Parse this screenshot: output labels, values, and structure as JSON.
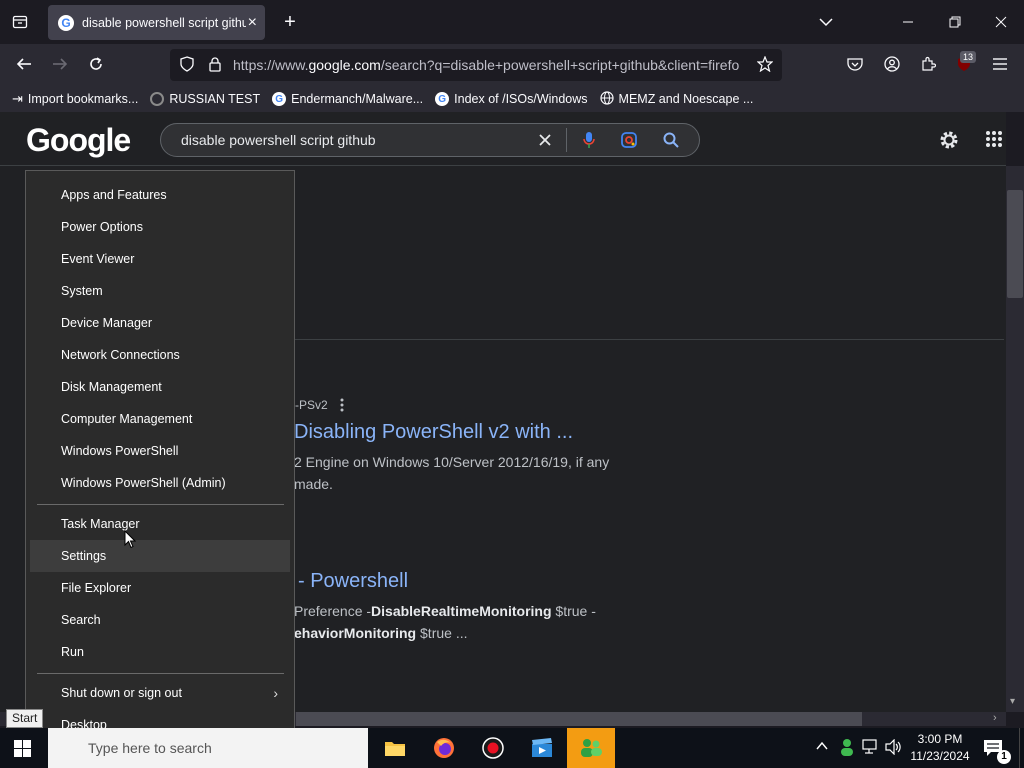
{
  "browser": {
    "tab_title": "disable powershell script github",
    "url_prefix": "https://www.",
    "url_host": "google.com",
    "url_rest": "/search?q=disable+powershell+script+github&client=firefo",
    "badge_count": "13",
    "bookmarks": [
      {
        "label": "Import bookmarks...",
        "icon": "import-icon"
      },
      {
        "label": "RUSSIAN TEST",
        "icon": "bookmark-favicon"
      },
      {
        "label": "Endermanch/Malware...",
        "icon": "google-favicon"
      },
      {
        "label": "Index of /ISOs/Windows",
        "icon": "google-favicon"
      },
      {
        "label": "MEMZ and Noescape ...",
        "icon": "globe-icon"
      }
    ]
  },
  "google": {
    "logo": "Google",
    "query": "disable powershell script github",
    "results": [
      {
        "crumb": "-PSv2",
        "title": "Disabling PowerShell v2 with ...",
        "snippet_1": "2 Engine on Windows 10/Server 2012/16/19, if any",
        "snippet_2": "made."
      },
      {
        "title": "- Powershell",
        "snippet_1a": "Preference -",
        "snippet_1b": "DisableRealtimeMonitoring",
        "snippet_1c": " $true -",
        "snippet_2a": "ehaviorMonitoring",
        "snippet_2b": " $true ..."
      }
    ]
  },
  "winx_menu": {
    "group1": [
      "Apps and Features",
      "Power Options",
      "Event Viewer",
      "System",
      "Device Manager",
      "Network Connections",
      "Disk Management",
      "Computer Management",
      "Windows PowerShell",
      "Windows PowerShell (Admin)"
    ],
    "group2": [
      "Task Manager",
      "Settings",
      "File Explorer",
      "Search",
      "Run"
    ],
    "group3": [
      "Shut down or sign out",
      "Desktop"
    ],
    "hovered": "Settings"
  },
  "taskbar": {
    "search_placeholder": "Type here to search",
    "tooltip": "Start",
    "time": "3:00 PM",
    "date": "11/23/2024"
  },
  "colors": {
    "link": "#8ab4f8",
    "page_bg": "#202124",
    "menu_bg": "#2b2b2b"
  }
}
